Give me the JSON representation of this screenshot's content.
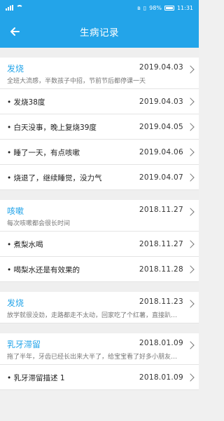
{
  "status": {
    "battery": "98%",
    "time": "11:31"
  },
  "header": {
    "title": "生病记录"
  },
  "groups": [
    {
      "name": "发烧",
      "date": "2019.04.03",
      "desc": "全班大流感，半数孩子中招，节前节后都停课一天",
      "items": [
        {
          "text": "• 发烧38度",
          "date": "2019.04.03"
        },
        {
          "text": "• 白天没事，晚上复烧39度",
          "date": "2019.04.05"
        },
        {
          "text": "• 睡了一天，有点咳嗽",
          "date": "2019.04.06"
        },
        {
          "text": "• 烧退了，继续睡觉，没力气",
          "date": "2019.04.07"
        }
      ]
    },
    {
      "name": "咳嗽",
      "date": "2018.11.27",
      "desc": "每次咳嗽都会很长时间",
      "items": [
        {
          "text": "• 煮梨水喝",
          "date": "2018.11.27"
        },
        {
          "text": "• 喝梨水还是有效果的",
          "date": "2018.11.28"
        }
      ]
    },
    {
      "name": "发烧",
      "date": "2018.11.23",
      "desc": "放学就很没劲，走路都走不太动，回家吃了个红薯，直接趴沙…",
      "items": []
    },
    {
      "name": "乳牙滞留",
      "date": "2018.01.09",
      "desc": "拖了半年，牙齿已经长出来大半了，给宝宝看了好多小朋友拔…",
      "items": [
        {
          "text": "• 乳牙滞留描述 1",
          "date": "2018.01.09"
        }
      ]
    }
  ]
}
